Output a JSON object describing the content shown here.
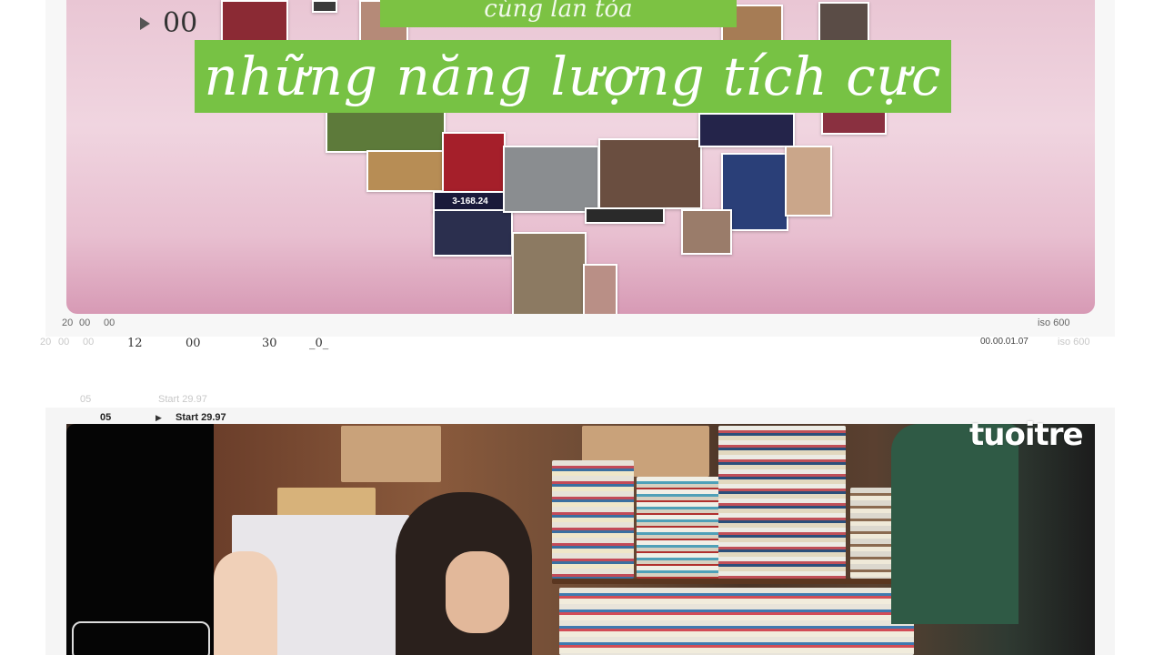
{
  "player": {
    "banner_top": "cùng lan tỏa",
    "banner_main": "những năng lượng tích cực",
    "overlay_time": "00",
    "photo_label": "3-168.24"
  },
  "timeline": {
    "row1": [
      "20",
      "00",
      "00"
    ],
    "row1_right": "iso 600",
    "row2_faded": [
      "20",
      "00",
      "00"
    ],
    "row2": [
      "12",
      "00",
      "30",
      "_0_"
    ],
    "row2_right": "00.00.01.07",
    "row2_right_faded": "iso 600"
  },
  "section2": {
    "faded_left": "05",
    "faded_label": "Start 29.97",
    "left": "05",
    "label": "Start 29.97",
    "watermark": "tuoitre"
  },
  "colors": {
    "banner_green": "#77c244",
    "pink_bg": "#e9c6d4"
  }
}
